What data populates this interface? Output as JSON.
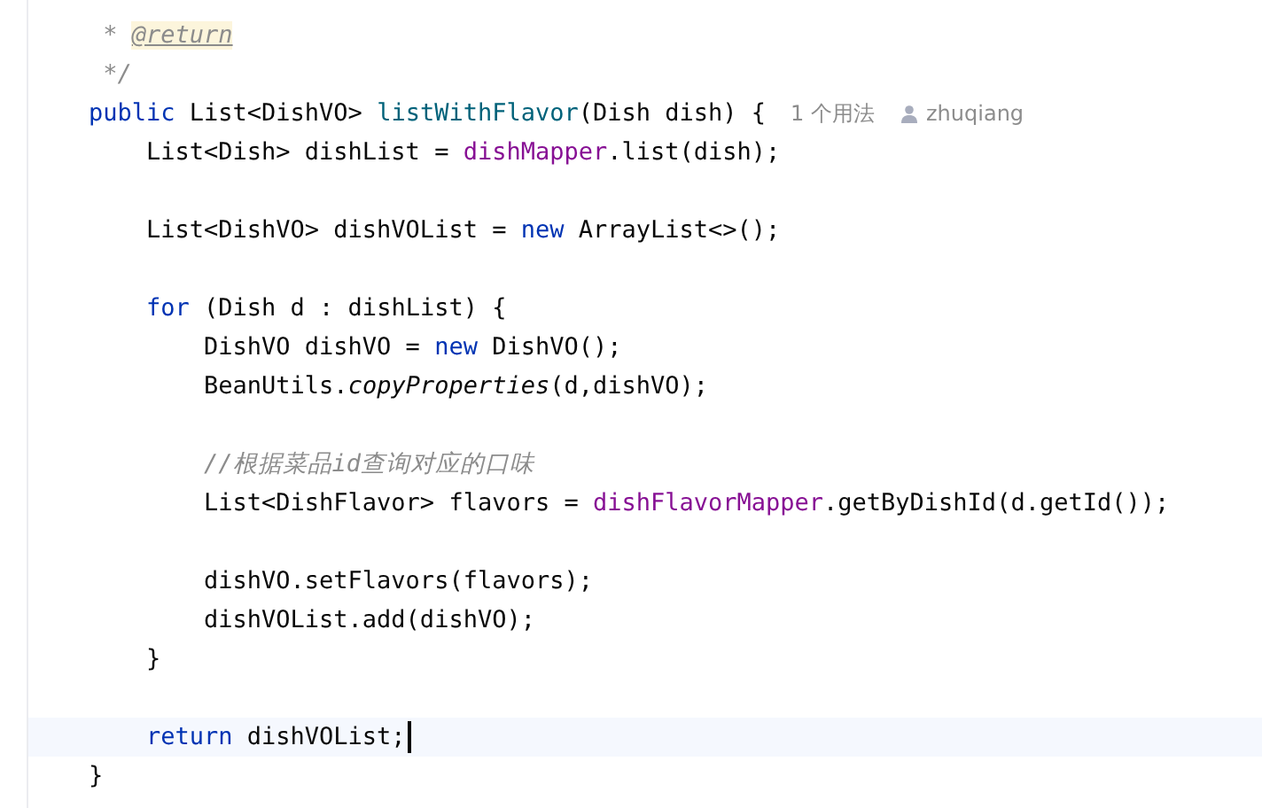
{
  "editor": {
    "lines": [
      {
        "tokens": [
          {
            "kind": "comment",
            "text": " * "
          },
          {
            "kind": "doctag",
            "text": "@return"
          }
        ]
      },
      {
        "tokens": [
          {
            "kind": "comment",
            "text": " */"
          }
        ]
      },
      {
        "tokens": [
          {
            "kind": "keyword",
            "text": "public "
          },
          {
            "kind": "plain",
            "text": "List<DishVO> "
          },
          {
            "kind": "decl",
            "text": "listWithFlavor"
          },
          {
            "kind": "plain",
            "text": "(Dish dish) {"
          }
        ],
        "usage_hint": "1 个用法",
        "author_hint": "zhuqiang"
      },
      {
        "tokens": [
          {
            "kind": "plain",
            "text": "    List<Dish> dishList = "
          },
          {
            "kind": "field",
            "text": "dishMapper"
          },
          {
            "kind": "plain",
            "text": ".list(dish);"
          }
        ]
      },
      {
        "kind": "blank"
      },
      {
        "tokens": [
          {
            "kind": "plain",
            "text": "    List<DishVO> dishVOList = "
          },
          {
            "kind": "keyword",
            "text": "new "
          },
          {
            "kind": "plain",
            "text": "ArrayList<>();"
          }
        ]
      },
      {
        "kind": "blank"
      },
      {
        "tokens": [
          {
            "kind": "keyword",
            "text": "    for "
          },
          {
            "kind": "plain",
            "text": "(Dish d : dishList) {"
          }
        ]
      },
      {
        "tokens": [
          {
            "kind": "plain",
            "text": "        DishVO dishVO = "
          },
          {
            "kind": "keyword",
            "text": "new "
          },
          {
            "kind": "plain",
            "text": "DishVO();"
          }
        ]
      },
      {
        "tokens": [
          {
            "kind": "plain",
            "text": "        BeanUtils."
          },
          {
            "kind": "static",
            "text": "copyProperties"
          },
          {
            "kind": "plain",
            "text": "(d,dishVO);"
          }
        ]
      },
      {
        "kind": "blank"
      },
      {
        "tokens": [
          {
            "kind": "comment",
            "text": "        //根据菜品id查询对应的口味"
          }
        ]
      },
      {
        "tokens": [
          {
            "kind": "plain",
            "text": "        List<DishFlavor> flavors = "
          },
          {
            "kind": "field",
            "text": "dishFlavorMapper"
          },
          {
            "kind": "plain",
            "text": ".getByDishId(d.getId());"
          }
        ]
      },
      {
        "kind": "blank"
      },
      {
        "tokens": [
          {
            "kind": "plain",
            "text": "        dishVO.setFlavors(flavors);"
          }
        ]
      },
      {
        "tokens": [
          {
            "kind": "plain",
            "text": "        dishVOList.add(dishVO);"
          }
        ]
      },
      {
        "tokens": [
          {
            "kind": "plain",
            "text": "    }"
          }
        ]
      },
      {
        "kind": "blank"
      },
      {
        "tokens": [
          {
            "kind": "keyword",
            "text": "    return "
          },
          {
            "kind": "plain",
            "text": "dishVOList;"
          }
        ],
        "current": true,
        "caret": true
      },
      {
        "tokens": [
          {
            "kind": "plain",
            "text": "}"
          }
        ]
      }
    ]
  }
}
